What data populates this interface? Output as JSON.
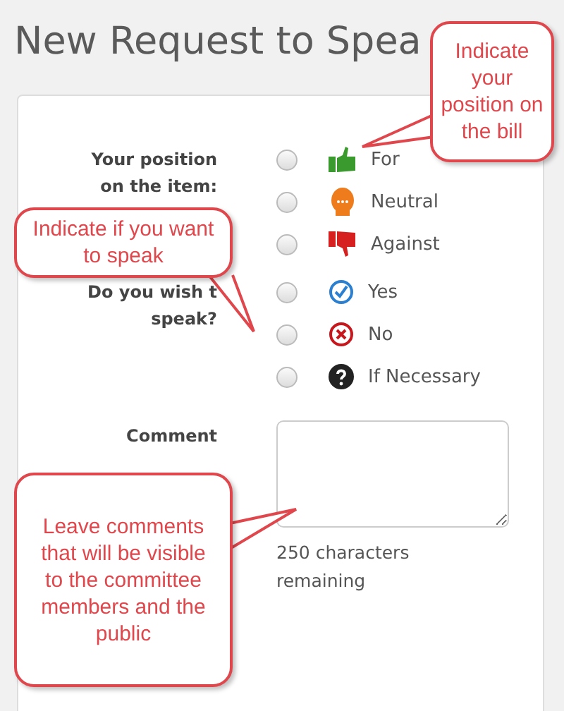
{
  "title": "New Request to Spea",
  "fields": [
    {
      "kind": "radio",
      "label_lines": [
        "Your position",
        "on the item:"
      ],
      "options": [
        {
          "label": "For",
          "selected": false
        },
        {
          "label": "Neutral",
          "selected": false
        },
        {
          "label": "Against",
          "selected": false
        }
      ]
    },
    {
      "kind": "radio",
      "label_lines": [
        "Do you wish t",
        "speak?"
      ],
      "options": [
        {
          "label": "Yes",
          "selected": false
        },
        {
          "label": "No",
          "selected": false
        },
        {
          "label": "If Necessary",
          "selected": false
        }
      ]
    },
    {
      "kind": "textarea",
      "label_lines": [
        "Comment"
      ],
      "hint": "250 characters remaining"
    }
  ],
  "callouts": [
    {
      "text": "Indicate your position on the bill"
    },
    {
      "text": "Indicate if you want to speak"
    },
    {
      "text": "Leave comments that will be visible to the committee members and the public"
    }
  ]
}
